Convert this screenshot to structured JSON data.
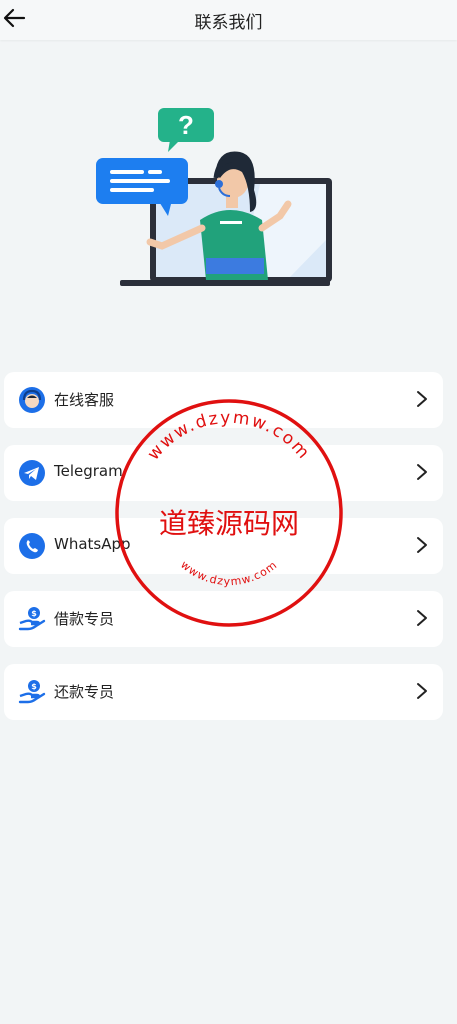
{
  "header": {
    "title": "联系我们"
  },
  "menu": [
    {
      "label": "在线客服",
      "icon": "customer-service-icon"
    },
    {
      "label": "Telegram",
      "icon": "telegram-icon"
    },
    {
      "label": "WhatsApp",
      "icon": "whatsapp-icon"
    },
    {
      "label": "借款专员",
      "icon": "loan-hand-icon"
    },
    {
      "label": "还款专员",
      "icon": "repay-hand-icon"
    }
  ],
  "watermark": {
    "main_text": "道臻源码网",
    "top_text": "www.dzymw.com",
    "bottom_text": "www.dzymw.com",
    "color": "#e01010"
  },
  "colors": {
    "background": "#f2f5f6",
    "accent_blue": "#1d6fe8",
    "hero_green": "#21a27b"
  }
}
